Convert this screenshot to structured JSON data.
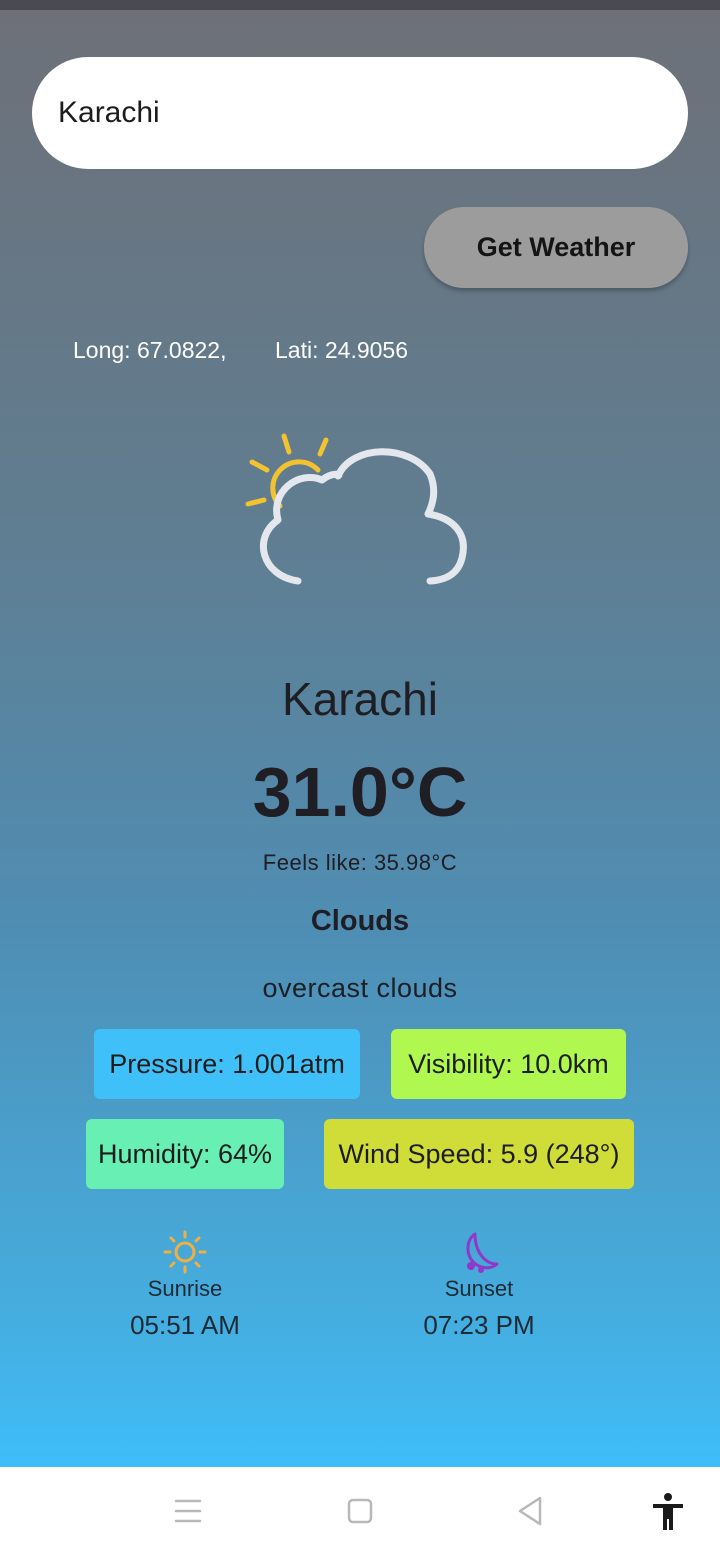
{
  "search": {
    "value": "Karachi"
  },
  "action": {
    "get_weather_label": "Get Weather"
  },
  "coords": {
    "longitude": "Long: 67.0822,",
    "latitude": "Lati: 24.9056"
  },
  "weather": {
    "icon": "partly-cloudy-icon",
    "city": "Karachi",
    "temperature": "31.0°C",
    "feels_like": "Feels like: 35.98°C",
    "main": "Clouds",
    "description": "overcast clouds"
  },
  "metrics": {
    "pressure": "Pressure: 1.001atm",
    "visibility": "Visibility: 10.0km",
    "humidity": "Humidity: 64%",
    "wind": "Wind Speed: 5.9 (248°)"
  },
  "sun": {
    "sunrise_label": "Sunrise",
    "sunrise_time": "05:51 AM",
    "sunset_label": "Sunset",
    "sunset_time": "07:23 PM"
  },
  "colors": {
    "pressure_chip": "#40c0f8",
    "visibility_chip": "#b0f850",
    "humidity_chip": "#68f0b4",
    "wind_chip": "#d0dc38",
    "sun_icon": "#f0b040",
    "moon_icon": "#9038c8"
  },
  "navbar": {
    "menu_icon": "menu-icon",
    "home_icon": "square-home-icon",
    "back_icon": "triangle-back-icon",
    "accessibility_icon": "accessibility-icon"
  }
}
